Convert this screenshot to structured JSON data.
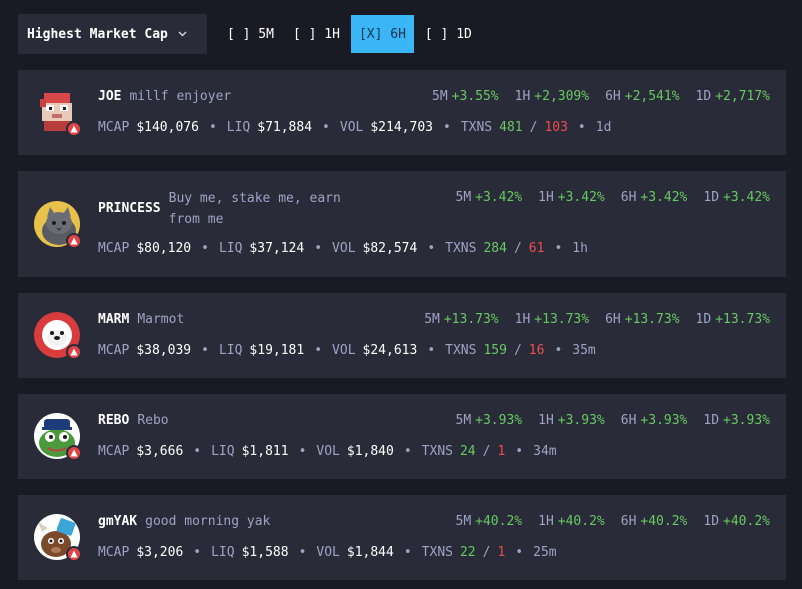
{
  "toolbar": {
    "sort_label": "Highest Market Cap",
    "sort_icon": "chevron-down-icon",
    "timeframes": [
      {
        "label": "[ ] 5M",
        "active": false
      },
      {
        "label": "[ ] 1H",
        "active": false
      },
      {
        "label": "[X] 6H",
        "active": true
      },
      {
        "label": "[ ] 1D",
        "active": false
      }
    ]
  },
  "labels": {
    "mcap": "MCAP",
    "liq": "LIQ",
    "vol": "VOL",
    "txns": "TXNS",
    "sep": "•",
    "slash": "/",
    "p5m": "5M",
    "p1h": "1H",
    "p6h": "6H",
    "p1d": "1D"
  },
  "colors": {
    "accent": "#3ab6f7",
    "positive": "#66c961",
    "negative": "#ee4d4d",
    "card": "#2a2b38",
    "bg": "#1a1a24"
  },
  "tokens": [
    {
      "ticker": "JOE",
      "name": "millf enjoyer",
      "avatar": "pixel-pig-avatar",
      "c5m": "+3.55%",
      "c1h": "+2,309%",
      "c6h": "+2,541%",
      "c1d": "+2,717%",
      "mcap": "$140,076",
      "liq": "$71,884",
      "vol": "$214,703",
      "buys": "481",
      "sells": "103",
      "age": "1d"
    },
    {
      "ticker": "PRINCESS",
      "name": "Buy me, stake me, earn from me",
      "avatar": "cat-avatar",
      "c5m": "+3.42%",
      "c1h": "+3.42%",
      "c6h": "+3.42%",
      "c1d": "+3.42%",
      "mcap": "$80,120",
      "liq": "$37,124",
      "vol": "$82,574",
      "buys": "284",
      "sells": "61",
      "age": "1h"
    },
    {
      "ticker": "MARM",
      "name": "Marmot",
      "avatar": "marmot-avatar",
      "c5m": "+13.73%",
      "c1h": "+13.73%",
      "c6h": "+13.73%",
      "c1d": "+13.73%",
      "mcap": "$38,039",
      "liq": "$19,181",
      "vol": "$24,613",
      "buys": "159",
      "sells": "16",
      "age": "35m"
    },
    {
      "ticker": "REBO",
      "name": "Rebo",
      "avatar": "frog-avatar",
      "c5m": "+3.93%",
      "c1h": "+3.93%",
      "c6h": "+3.93%",
      "c1d": "+3.93%",
      "mcap": "$3,666",
      "liq": "$1,811",
      "vol": "$1,840",
      "buys": "24",
      "sells": "1",
      "age": "34m"
    },
    {
      "ticker": "gmYAK",
      "name": "good morning yak",
      "avatar": "yak-avatar",
      "c5m": "+40.2%",
      "c1h": "+40.2%",
      "c6h": "+40.2%",
      "c1d": "+40.2%",
      "mcap": "$3,206",
      "liq": "$1,588",
      "vol": "$1,844",
      "buys": "22",
      "sells": "1",
      "age": "25m"
    }
  ]
}
